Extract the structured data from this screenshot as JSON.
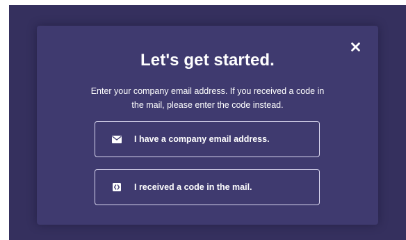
{
  "modal": {
    "title": "Let's get started.",
    "subtitle": "Enter your company email address. If you received a code in the mail, please enter the code instead.",
    "close_icon": "close-icon",
    "options": [
      {
        "label": "I have a company email address.",
        "icon": "envelope-icon"
      },
      {
        "label": "I received a code in the mail.",
        "icon": "code-brackets-icon"
      }
    ]
  },
  "colors": {
    "backdrop": "#35305e",
    "modal_background": "#3f3a6f",
    "option_border": "#d9d6ee",
    "text": "#ffffff"
  }
}
